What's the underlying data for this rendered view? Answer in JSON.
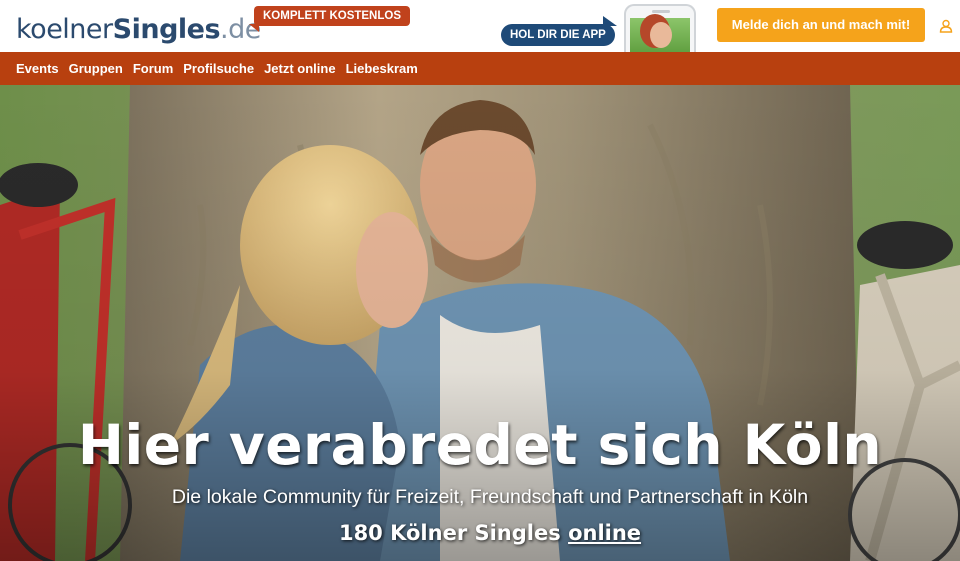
{
  "header": {
    "logo": {
      "part1": "koelner",
      "part2": "Singles",
      "part3": ".de"
    },
    "free_badge": "KOMPLETT KOSTENLOS",
    "app_badge": "HOL DIR DIE APP",
    "cta_label": "Melde dich an und mach mit!",
    "user_icon": "user-icon"
  },
  "nav": {
    "items": [
      {
        "label": "Events"
      },
      {
        "label": "Gruppen"
      },
      {
        "label": "Forum"
      },
      {
        "label": "Profilsuche"
      },
      {
        "label": "Jetzt online"
      },
      {
        "label": "Liebeskram"
      }
    ]
  },
  "hero": {
    "title": "Hier verabredet sich Köln",
    "subtitle": "Die lokale Community für Freizeit, Freundschaft und Partnerschaft in Köln",
    "online_count_text": "180 Kölner Singles",
    "online_link": "online"
  },
  "colors": {
    "brand_navy": "#2b4a6e",
    "nav_bar": "#b8400f",
    "badge_red": "#c0421c",
    "cta_orange": "#f5a31b",
    "app_badge_blue": "#1e4a78"
  }
}
